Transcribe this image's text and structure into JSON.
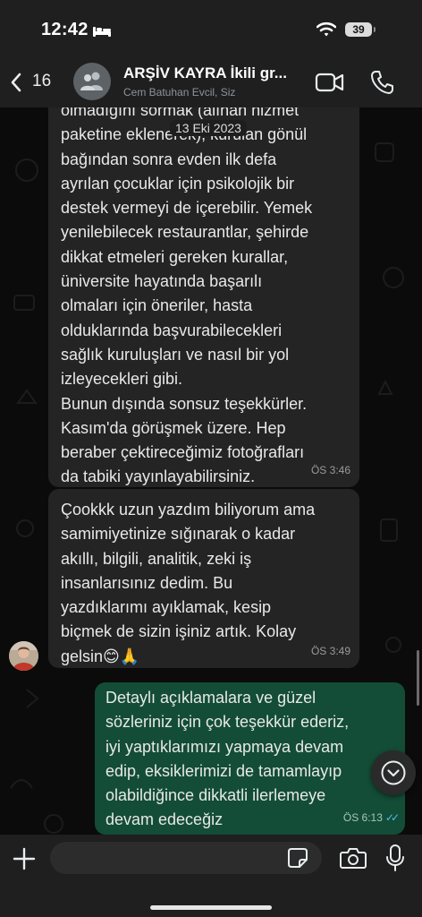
{
  "status_bar": {
    "time": "12:42",
    "battery": "39"
  },
  "header": {
    "unread_count": "16",
    "title": "ARŞİV KAYRA İkili gr...",
    "subtitle": "Cem Batuhan Evcil, Siz"
  },
  "date_chip": "13 Eki 2023",
  "messages": [
    {
      "direction": "incoming",
      "text": "olmadığını sormak (alınan hizmet\npaketine eklenerek), kurulan gönül\nbağından sonra evden ilk defa\nayrılan çocuklar için psikolojik bir\ndestek vermeyi de içerebilir. Yemek\nyenilebilecek restaurantlar, şehirde\ndikkat etmeleri gereken kurallar,\nüniversite hayatında başarılı\nolmaları için öneriler, hasta\nolduklarında başvurabilecekleri\nsağlık kuruluşları ve nasıl bir yol\nizleyecekleri gibi.\nBunun dışında sonsuz teşekkürler.\nKasım'da görüşmek üzere. Hep\nberaber çektireceğimiz fotoğrafları\nda tabiki yayınlayabilirsiniz.",
      "time": "ÖS 3:46"
    },
    {
      "direction": "incoming",
      "text": "Çookkk uzun yazdım biliyorum ama\nsamimiyetinize sığınarak o kadar\nakıllı, bilgili, analitik, zeki iş\ninsanlarısınız dedim. Bu\nyazdıklarımı ayıklamak, kesip\nbiçmek de sizin işiniz artık. Kolay\ngelsin😊🙏",
      "time": "ÖS 3:49"
    },
    {
      "direction": "outgoing",
      "text": "Detaylı açıklamalara ve güzel\nsözleriniz için çok teşekkür ederiz,\niyi yaptıklarımızı yapmaya devam\nedip, eksiklerimizi de tamamlayıp\nolabildiğince dikkatli ilerlemeye\ndevam edeceğiz",
      "time": "ÖS 6:13",
      "status": "read"
    }
  ],
  "composer": {
    "value": ""
  },
  "icons": {
    "back": "chevron-left-icon",
    "group_avatar": "group-icon",
    "video": "video-camera-icon",
    "call": "phone-icon",
    "scroll_down": "chevron-down-icon",
    "attach": "plus-icon",
    "sticker": "sticker-icon",
    "camera": "camera-icon",
    "mic": "microphone-icon"
  },
  "colors": {
    "incoming_bubble": "#242424",
    "outgoing_bubble": "#134d37",
    "read_ticks": "#53bdeb",
    "header_bg": "#1f1f1f"
  }
}
